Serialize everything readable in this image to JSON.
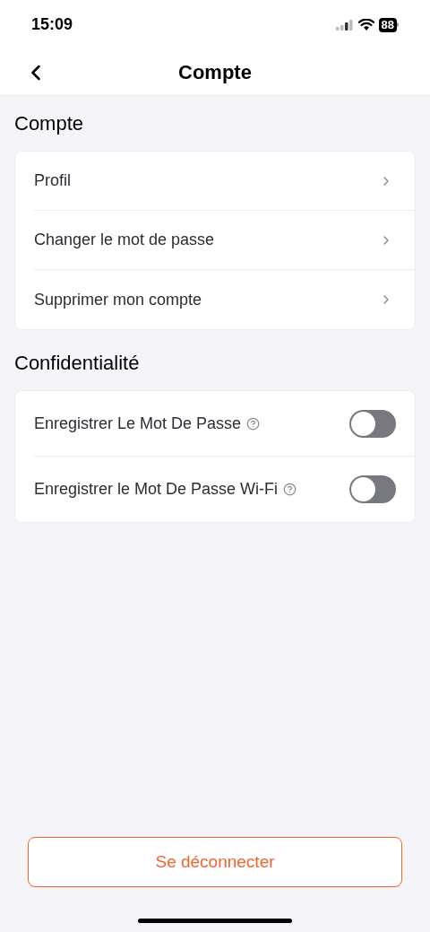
{
  "status_bar": {
    "time": "15:09",
    "battery": "88"
  },
  "header": {
    "title": "Compte"
  },
  "sections": [
    {
      "title": "Compte",
      "items": [
        {
          "kind": "link",
          "label": "Profil"
        },
        {
          "kind": "link",
          "label": "Changer le mot de passe"
        },
        {
          "kind": "link",
          "label": "Supprimer mon compte"
        }
      ]
    },
    {
      "title": "Confidentialité",
      "items": [
        {
          "kind": "toggle",
          "label": "Enregistrer Le Mot De Passe",
          "on": false
        },
        {
          "kind": "toggle",
          "label": "Enregistrer le Mot De Passe Wi-Fi",
          "on": false
        }
      ]
    }
  ],
  "logout_button": "Se déconnecter"
}
